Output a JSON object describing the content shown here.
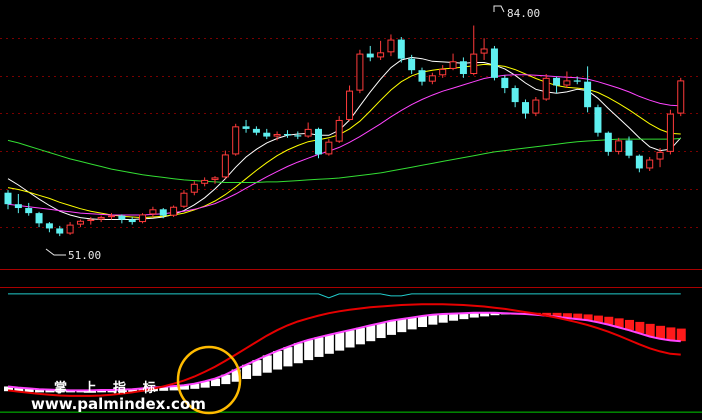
{
  "colors": {
    "background": "#000000",
    "grid": "#7a0000",
    "up_candle": "#ff3b3b",
    "down_candle": "#5ff0f0",
    "ma_fast": "#ffffff",
    "ma_mid": "#ffff00",
    "ma_slow": "#ff44ff",
    "ma_long": "#33dd33",
    "indicator_fill": "#ff1a1a",
    "indicator_line": "#e60000",
    "indicator_line2": "#ff44ff",
    "signal_line": "#22cccc",
    "base_line": "#00cc00",
    "highlight_circle": "#ffbb00"
  },
  "annotations": {
    "high_label": "84.00",
    "low_label": "51.00"
  },
  "watermark": {
    "chinese": "掌 上 指 标",
    "url": "www.palmindex.com"
  },
  "chart_data": [
    {
      "type": "candlestick",
      "title": "",
      "price_range": [
        46,
        88
      ],
      "high": 84.0,
      "low": 51.0,
      "ohlc": [
        [
          57.8,
          58.2,
          55.2,
          56.0
        ],
        [
          56.0,
          57.6,
          54.6,
          55.4
        ],
        [
          55.4,
          56.2,
          54.2,
          54.6
        ],
        [
          54.6,
          54.8,
          52.4,
          53.0
        ],
        [
          53.0,
          53.2,
          51.6,
          52.2
        ],
        [
          52.2,
          52.6,
          51.0,
          51.4
        ],
        [
          51.4,
          53.2,
          51.2,
          52.8
        ],
        [
          52.8,
          53.6,
          52.4,
          53.4
        ],
        [
          53.4,
          54.0,
          52.8,
          53.6
        ],
        [
          53.6,
          54.2,
          53.2,
          54.0
        ],
        [
          54.0,
          54.6,
          53.6,
          54.2
        ],
        [
          54.2,
          54.4,
          53.0,
          53.6
        ],
        [
          53.6,
          54.0,
          52.8,
          53.2
        ],
        [
          53.2,
          54.6,
          53.0,
          54.4
        ],
        [
          54.4,
          55.6,
          54.0,
          55.2
        ],
        [
          55.2,
          55.4,
          53.8,
          54.2
        ],
        [
          54.2,
          55.8,
          54.0,
          55.6
        ],
        [
          55.6,
          58.2,
          55.4,
          57.8
        ],
        [
          57.8,
          59.6,
          57.4,
          59.2
        ],
        [
          59.2,
          60.2,
          58.8,
          59.8
        ],
        [
          59.8,
          60.4,
          59.2,
          60.2
        ],
        [
          60.2,
          64.4,
          60.0,
          63.8
        ],
        [
          63.8,
          68.6,
          63.6,
          68.2
        ],
        [
          68.2,
          69.2,
          67.2,
          67.8
        ],
        [
          67.8,
          68.2,
          66.8,
          67.2
        ],
        [
          67.2,
          67.8,
          66.2,
          66.6
        ],
        [
          66.6,
          67.4,
          66.0,
          67.0
        ],
        [
          67.0,
          67.6,
          66.4,
          66.8
        ],
        [
          66.8,
          67.4,
          66.2,
          66.6
        ],
        [
          66.6,
          68.8,
          66.4,
          67.8
        ],
        [
          67.8,
          68.0,
          63.2,
          63.8
        ],
        [
          63.8,
          66.2,
          63.6,
          65.8
        ],
        [
          65.8,
          69.8,
          65.6,
          69.2
        ],
        [
          69.2,
          74.6,
          69.0,
          73.8
        ],
        [
          73.8,
          80.2,
          73.4,
          79.6
        ],
        [
          79.6,
          80.8,
          78.4,
          79.0
        ],
        [
          79.0,
          81.6,
          78.6,
          79.8
        ],
        [
          79.8,
          82.6,
          79.2,
          81.8
        ],
        [
          81.8,
          82.2,
          78.2,
          78.8
        ],
        [
          78.8,
          79.4,
          76.4,
          77.0
        ],
        [
          77.0,
          77.4,
          74.6,
          75.2
        ],
        [
          75.2,
          76.6,
          74.8,
          76.2
        ],
        [
          76.2,
          77.8,
          75.8,
          77.2
        ],
        [
          77.2,
          79.6,
          77.0,
          78.4
        ],
        [
          78.4,
          79.0,
          75.8,
          76.4
        ],
        [
          76.4,
          84.0,
          76.2,
          79.6
        ],
        [
          79.6,
          82.0,
          78.6,
          80.4
        ],
        [
          80.4,
          80.8,
          75.4,
          75.8
        ],
        [
          75.8,
          76.2,
          73.4,
          74.2
        ],
        [
          74.2,
          74.6,
          71.2,
          72.0
        ],
        [
          72.0,
          72.4,
          69.4,
          70.2
        ],
        [
          70.2,
          72.8,
          69.8,
          72.4
        ],
        [
          72.4,
          76.4,
          72.2,
          75.8
        ],
        [
          75.8,
          76.0,
          73.4,
          74.6
        ],
        [
          74.6,
          76.8,
          74.2,
          75.4
        ],
        [
          75.4,
          76.0,
          74.8,
          75.2
        ],
        [
          75.2,
          77.6,
          70.4,
          71.2
        ],
        [
          71.2,
          71.6,
          66.6,
          67.2
        ],
        [
          67.2,
          67.4,
          63.6,
          64.2
        ],
        [
          64.2,
          66.4,
          63.8,
          66.0
        ],
        [
          66.0,
          66.6,
          63.2,
          63.6
        ],
        [
          63.6,
          63.8,
          61.0,
          61.6
        ],
        [
          61.6,
          63.4,
          61.2,
          63.0
        ],
        [
          63.0,
          64.8,
          61.8,
          64.2
        ],
        [
          64.2,
          70.8,
          63.8,
          70.2
        ],
        [
          70.2,
          75.8,
          69.8,
          75.4
        ]
      ],
      "moving_averages": [
        {
          "values": [
            60.0,
            59.0,
            57.9,
            56.8,
            55.8,
            54.9,
            54.3,
            53.9,
            53.7,
            53.6,
            53.6,
            53.6,
            53.6,
            53.7,
            53.8,
            54.0,
            54.4,
            55.0,
            55.9,
            57.0,
            58.4,
            60.0,
            61.8,
            63.4,
            64.6,
            65.6,
            66.3,
            66.8,
            67.0,
            67.1,
            66.8,
            66.8,
            67.6,
            69.2,
            71.4,
            73.6,
            75.6,
            77.4,
            78.6,
            79.0,
            78.8,
            78.4,
            78.3,
            78.2,
            78.1,
            78.2,
            78.2,
            77.8,
            77.2,
            76.2,
            75.0,
            74.0,
            73.6,
            73.4,
            73.6,
            74.0,
            73.8,
            72.6,
            71.0,
            69.5,
            68.0,
            66.4,
            65.0,
            64.4,
            64.6,
            66.4
          ]
        },
        {
          "values": [
            58.6,
            58.3,
            57.9,
            57.4,
            56.9,
            56.3,
            55.8,
            55.3,
            54.9,
            54.6,
            54.3,
            54.1,
            54.0,
            53.9,
            54.0,
            54.1,
            54.3,
            54.6,
            55.1,
            55.7,
            56.5,
            57.5,
            58.7,
            60.0,
            61.3,
            62.5,
            63.6,
            64.5,
            65.2,
            65.8,
            66.1,
            66.4,
            66.9,
            67.8,
            69.0,
            70.6,
            72.3,
            73.9,
            75.2,
            76.1,
            76.7,
            77.0,
            77.2,
            77.3,
            77.5,
            77.7,
            77.9,
            77.8,
            77.6,
            77.1,
            76.4,
            75.7,
            75.1,
            74.6,
            74.3,
            74.2,
            74.0,
            73.5,
            72.7,
            71.8,
            70.8,
            69.7,
            68.6,
            67.7,
            67.1,
            67.0
          ]
        },
        {
          "values": [
            56.0,
            55.8,
            55.6,
            55.4,
            55.2,
            55.0,
            54.8,
            54.6,
            54.5,
            54.4,
            54.3,
            54.3,
            54.3,
            54.3,
            54.4,
            54.5,
            54.7,
            54.9,
            55.2,
            55.6,
            56.1,
            56.8,
            57.6,
            58.5,
            59.4,
            60.3,
            61.1,
            61.9,
            62.6,
            63.2,
            63.8,
            64.3,
            64.9,
            65.7,
            66.6,
            67.6,
            68.6,
            69.7,
            70.7,
            71.6,
            72.4,
            73.1,
            73.7,
            74.2,
            74.7,
            75.2,
            75.7,
            76.0,
            76.2,
            76.3,
            76.3,
            76.2,
            76.1,
            76.0,
            75.9,
            75.8,
            75.6,
            75.2,
            74.7,
            74.2,
            73.6,
            72.9,
            72.3,
            71.8,
            71.5,
            71.4
          ]
        },
        {
          "values": [
            66.0,
            65.6,
            65.1,
            64.6,
            64.1,
            63.6,
            63.1,
            62.7,
            62.3,
            61.9,
            61.5,
            61.2,
            60.9,
            60.6,
            60.4,
            60.2,
            60.0,
            59.8,
            59.7,
            59.6,
            59.5,
            59.4,
            59.4,
            59.4,
            59.4,
            59.5,
            59.5,
            59.6,
            59.7,
            59.8,
            59.9,
            60.0,
            60.1,
            60.3,
            60.5,
            60.7,
            60.9,
            61.2,
            61.5,
            61.8,
            62.1,
            62.4,
            62.7,
            63.0,
            63.3,
            63.6,
            63.9,
            64.2,
            64.4,
            64.6,
            64.8,
            65.0,
            65.2,
            65.4,
            65.6,
            65.8,
            65.9,
            66.0,
            66.1,
            66.2,
            66.2,
            66.2,
            66.2,
            66.2,
            66.2,
            66.3
          ]
        }
      ]
    },
    {
      "type": "area",
      "title": "",
      "y_range": [
        -1.6,
        1.6
      ],
      "values_a": [
        -0.85,
        -0.88,
        -0.9,
        -0.92,
        -0.93,
        -0.94,
        -0.95,
        -0.95,
        -0.95,
        -0.94,
        -0.94,
        -0.93,
        -0.92,
        -0.9,
        -0.88,
        -0.86,
        -0.84,
        -0.82,
        -0.78,
        -0.72,
        -0.65,
        -0.55,
        -0.42,
        -0.3,
        -0.18,
        -0.06,
        0.05,
        0.15,
        0.25,
        0.33,
        0.4,
        0.46,
        0.52,
        0.58,
        0.64,
        0.7,
        0.76,
        0.82,
        0.86,
        0.9,
        0.94,
        0.97,
        0.99,
        1.0,
        1.01,
        1.02,
        1.02,
        1.02,
        1.01,
        1.0,
        0.99,
        0.97,
        0.95,
        0.92,
        0.89,
        0.86,
        0.83,
        0.78,
        0.72,
        0.65,
        0.58,
        0.5,
        0.42,
        0.36,
        0.32,
        0.3
      ],
      "values_b": [
        -0.97,
        -0.98,
        -0.99,
        -1.0,
        -1.0,
        -1.0,
        -1.0,
        -1.0,
        -1.0,
        -1.0,
        -1.0,
        -0.99,
        -0.99,
        -0.98,
        -0.97,
        -0.96,
        -0.95,
        -0.93,
        -0.91,
        -0.88,
        -0.84,
        -0.79,
        -0.73,
        -0.66,
        -0.58,
        -0.5,
        -0.42,
        -0.34,
        -0.26,
        -0.18,
        -0.1,
        -0.02,
        0.06,
        0.14,
        0.22,
        0.3,
        0.38,
        0.46,
        0.53,
        0.6,
        0.66,
        0.72,
        0.77,
        0.82,
        0.86,
        0.9,
        0.93,
        0.96,
        0.98,
        1.0,
        1.01,
        1.02,
        1.02,
        1.02,
        1.01,
        1.0,
        0.98,
        0.95,
        0.92,
        0.88,
        0.84,
        0.79,
        0.74,
        0.69,
        0.65,
        0.62
      ],
      "line_c": [
        -0.95,
        -0.98,
        -1.01,
        -1.04,
        -1.06,
        -1.08,
        -1.09,
        -1.09,
        -1.09,
        -1.08,
        -1.06,
        -1.03,
        -1.0,
        -0.96,
        -0.91,
        -0.85,
        -0.78,
        -0.7,
        -0.6,
        -0.48,
        -0.35,
        -0.2,
        -0.04,
        0.12,
        0.28,
        0.44,
        0.58,
        0.7,
        0.8,
        0.88,
        0.95,
        1.01,
        1.06,
        1.1,
        1.13,
        1.16,
        1.18,
        1.2,
        1.22,
        1.23,
        1.24,
        1.24,
        1.24,
        1.23,
        1.22,
        1.2,
        1.18,
        1.15,
        1.12,
        1.08,
        1.04,
        1.0,
        0.95,
        0.9,
        0.84,
        0.78,
        0.71,
        0.63,
        0.54,
        0.44,
        0.33,
        0.22,
        0.12,
        0.04,
        -0.02,
        -0.04
      ],
      "signal_line": [
        1.5,
        1.5,
        1.5,
        1.5,
        1.5,
        1.5,
        1.5,
        1.5,
        1.5,
        1.5,
        1.5,
        1.5,
        1.5,
        1.5,
        1.5,
        1.5,
        1.5,
        1.5,
        1.5,
        1.5,
        1.5,
        1.5,
        1.5,
        1.5,
        1.5,
        1.5,
        1.5,
        1.5,
        1.5,
        1.5,
        1.5,
        1.4,
        1.5,
        1.5,
        1.5,
        1.5,
        1.5,
        1.45,
        1.45,
        1.5,
        1.5,
        1.5,
        1.5,
        1.5,
        1.5,
        1.5,
        1.5,
        1.5,
        1.5,
        1.5,
        1.5,
        1.5,
        1.5,
        1.5,
        1.5,
        1.5,
        1.5,
        1.5,
        1.5,
        1.5,
        1.5,
        1.5,
        1.5,
        1.5,
        1.5,
        1.5
      ]
    }
  ]
}
